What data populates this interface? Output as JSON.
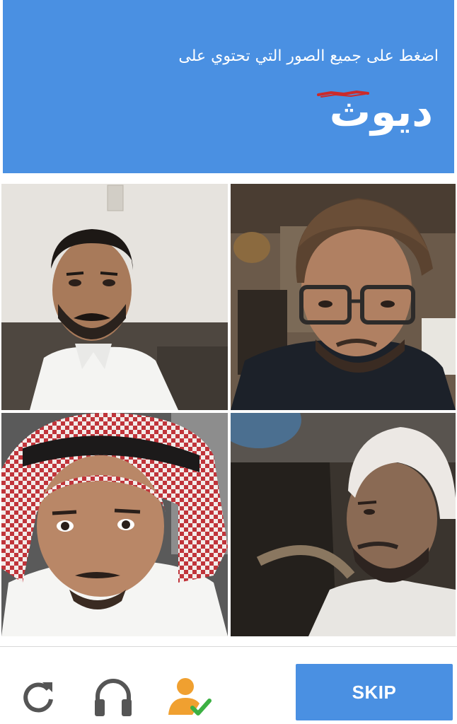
{
  "header": {
    "instruction": "اضغط على جميع الصور التي تحتوي على",
    "keyword": "ديوث"
  },
  "grid": {
    "tiles": [
      {
        "index": 1,
        "icon": "face-photo"
      },
      {
        "index": 2,
        "icon": "face-photo"
      },
      {
        "index": 3,
        "icon": "face-photo"
      },
      {
        "index": 4,
        "icon": "face-photo"
      }
    ]
  },
  "footer": {
    "reload_icon": "reload-icon",
    "audio_icon": "headphones-icon",
    "info_icon": "person-check-icon",
    "skip_label": "SKIP"
  },
  "colors": {
    "accent": "#4a90e2",
    "icon_gray": "#555555",
    "icon_orange": "#f0a030",
    "check_green": "#3cb043",
    "strike_red": "#cc2a2a"
  }
}
